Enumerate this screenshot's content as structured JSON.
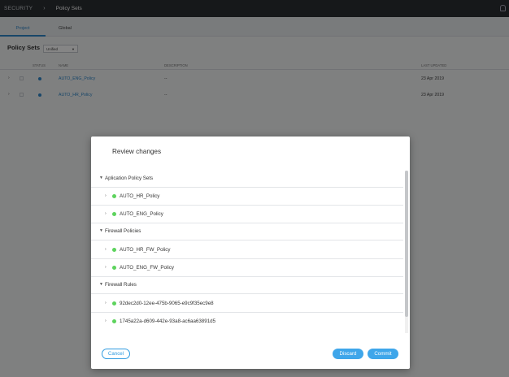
{
  "topbar": {
    "root": "SECURITY",
    "separator": "›",
    "page": "Policy Sets"
  },
  "tabs": [
    {
      "label": "Project",
      "active": true
    },
    {
      "label": "Global",
      "active": false
    }
  ],
  "policy_sets": {
    "header": "Policy Sets",
    "filter_value": "Unified"
  },
  "table": {
    "columns": {
      "status": "STATUS",
      "name": "NAME",
      "description": "DESCRIPTION",
      "last_updated": "LAST UPDATED"
    },
    "rows": [
      {
        "name": "AUTO_ENG_Policy",
        "description": "--",
        "last_updated": "23 Apr 2019"
      },
      {
        "name": "AUTO_HR_Policy",
        "description": "--",
        "last_updated": "23 Apr 2019"
      }
    ]
  },
  "modal": {
    "title": "Review changes",
    "sections": [
      {
        "label": "Aplication Policy Sets",
        "items": [
          "AUTO_HR_Policy",
          "AUTO_ENG_Policy"
        ]
      },
      {
        "label": "Firewall Policies",
        "items": [
          "AUTO_HR_FW_Policy",
          "AUTO_ENG_FW_Policy"
        ]
      },
      {
        "label": "Firewall Rules",
        "items": [
          "92dec2d0-12ee-475b-9065-e9c9f35ec9e8",
          "1745a22a-d609-442e-93a8-ac6aa63891d5"
        ]
      }
    ],
    "buttons": {
      "cancel": "Cancel",
      "discard": "Discard",
      "commit": "Commit"
    }
  },
  "colors": {
    "accent": "#3fa6ea",
    "status_green": "#5dd35d",
    "status_blue": "#2f87c9",
    "topbar": "#2b2e33"
  }
}
